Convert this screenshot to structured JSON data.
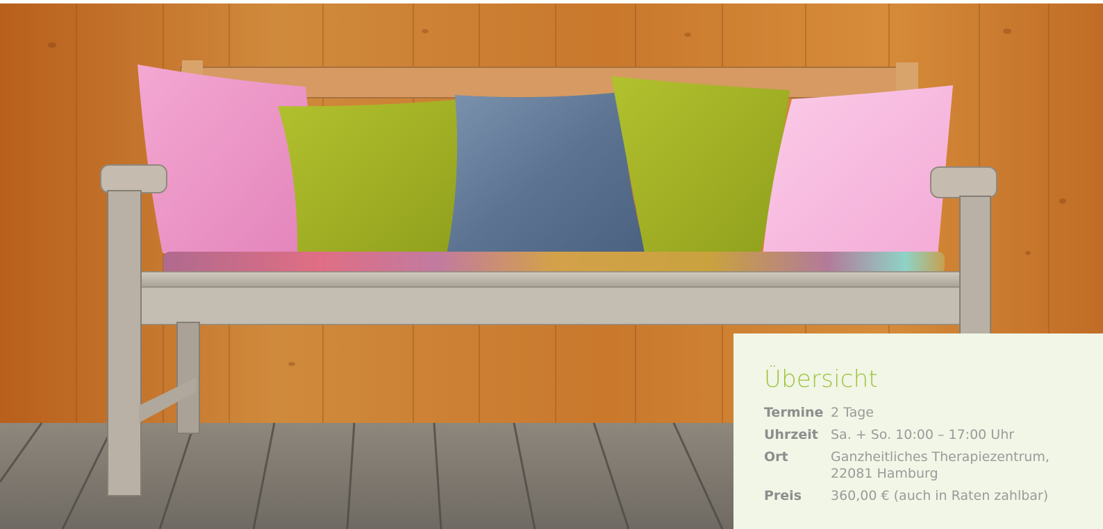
{
  "hero": {
    "image_name": "wooden-bench-with-cushions",
    "colors": {
      "wall": "#c7762c",
      "floor": "#7f7b74",
      "bench": "#bdb6aa",
      "pink_cushion": "#ef9fca",
      "green_cushion": "#a4b428",
      "blue_cushion": "#5e7694",
      "light_pink_cushion": "#f7bce0"
    }
  },
  "overview": {
    "title": "Übersicht",
    "accent_color": "#9ec23b",
    "background_color": "#f1f6e6",
    "rows": [
      {
        "label": "Termine",
        "value": "2 Tage"
      },
      {
        "label": "Uhrzeit",
        "value": "Sa. + So. 10:00 – 17:00 Uhr"
      },
      {
        "label": "Ort",
        "value_line1": "Ganzheitliches Therapiezentrum,",
        "value_line2": "22081 Hamburg"
      },
      {
        "label": "Preis",
        "value": "360,00 € (auch in Raten zahlbar)"
      }
    ]
  }
}
